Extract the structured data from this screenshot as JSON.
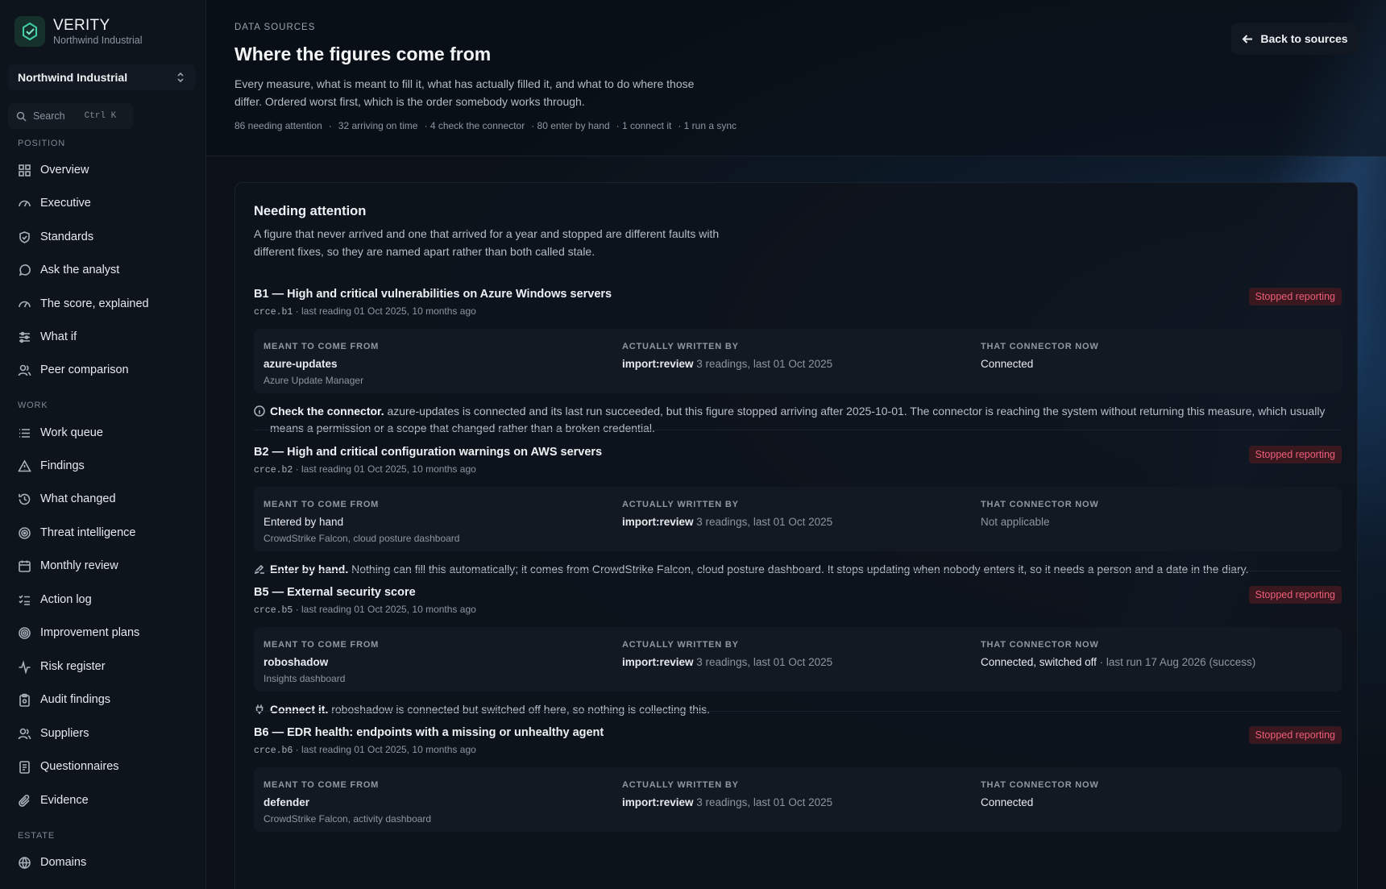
{
  "brand": {
    "name": "VERITY",
    "org": "Northwind Industrial"
  },
  "org_switcher": {
    "label": "Northwind Industrial"
  },
  "search": {
    "label": "Search",
    "shortcut": "Ctrl K"
  },
  "sidebar": {
    "sections": [
      {
        "label": "POSITION"
      },
      {
        "label": "WORK"
      },
      {
        "label": "ESTATE"
      }
    ],
    "items": [
      {
        "label": "Overview",
        "icon": "grid-icon"
      },
      {
        "label": "Executive",
        "icon": "gauge-icon"
      },
      {
        "label": "Standards",
        "icon": "shield-icon"
      },
      {
        "label": "Ask the analyst",
        "icon": "chat-icon"
      },
      {
        "label": "The score, explained",
        "icon": "gauge-icon"
      },
      {
        "label": "What if",
        "icon": "sliders-icon"
      },
      {
        "label": "Peer comparison",
        "icon": "users-icon"
      },
      {
        "label": "Work queue",
        "icon": "list-icon"
      },
      {
        "label": "Findings",
        "icon": "warning-icon"
      },
      {
        "label": "What changed",
        "icon": "history-icon"
      },
      {
        "label": "Threat intelligence",
        "icon": "radar-icon"
      },
      {
        "label": "Monthly review",
        "icon": "calendar-icon"
      },
      {
        "label": "Action log",
        "icon": "checklist-icon"
      },
      {
        "label": "Improvement plans",
        "icon": "target-icon"
      },
      {
        "label": "Risk register",
        "icon": "pulse-icon"
      },
      {
        "label": "Audit findings",
        "icon": "clipboard-icon"
      },
      {
        "label": "Suppliers",
        "icon": "users-icon"
      },
      {
        "label": "Questionnaires",
        "icon": "form-icon"
      },
      {
        "label": "Evidence",
        "icon": "paperclip-icon"
      },
      {
        "label": "Domains",
        "icon": "globe-icon"
      }
    ]
  },
  "header": {
    "eyebrow": "DATA SOURCES",
    "title": "Where the figures come from",
    "description": "Every measure, what is meant to fill it, what has actually filled it, and what to do where those differ. Ordered worst first, which is the order somebody works through.",
    "stats": [
      "86 needing attention",
      "·",
      "32 arriving on time",
      "· 4 check the connector",
      "· 80 enter by hand",
      "· 1 connect it",
      "· 1 run a sync"
    ],
    "back_label": "Back to sources"
  },
  "panel": {
    "title": "Needing attention",
    "description": "A figure that never arrived and one that arrived for a year and stopped are different faults with different fixes, so they are named apart rather than both called stale.",
    "col_labels": {
      "from": "MEANT TO COME FROM",
      "written": "ACTUALLY WRITTEN BY",
      "connector": "THAT CONNECTOR NOW"
    },
    "items": [
      {
        "title": "B1 — High and critical vulnerabilities on Azure Windows servers",
        "code": "crce.b1",
        "meta": " · last reading 01 Oct 2025, 10 months ago",
        "badge": "Stopped reporting",
        "from": "azure-updates",
        "from_sub": "Azure Update Manager",
        "written": "import:review",
        "written_meta": " 3 readings, last 01 Oct 2025",
        "connector": "Connected",
        "connector_meta": "",
        "note_title": "Check the connector.",
        "note_text": " azure-updates is connected and its last run succeeded, but this figure stopped arriving after 2025-10-01. The connector is reaching the system without returning this measure, which usually means a permission or a scope that changed rather than a broken credential."
      },
      {
        "title": "B2 — High and critical configuration warnings on AWS servers",
        "code": "crce.b2",
        "meta": " · last reading 01 Oct 2025, 10 months ago",
        "badge": "Stopped reporting",
        "from": "Entered by hand",
        "from_sub": "CrowdStrike Falcon, cloud posture dashboard",
        "written": "import:review",
        "written_meta": " 3 readings, last 01 Oct 2025",
        "connector": "Not applicable",
        "connector_meta": "",
        "note_title": "Enter by hand.",
        "note_text": " Nothing can fill this automatically; it comes from CrowdStrike Falcon, cloud posture dashboard. It stops updating when nobody enters it, so it needs a person and a date in the diary."
      },
      {
        "title": "B5 — External security score",
        "code": "crce.b5",
        "meta": " · last reading 01 Oct 2025, 10 months ago",
        "badge": "Stopped reporting",
        "from": "roboshadow",
        "from_sub": "Insights dashboard",
        "written": "import:review",
        "written_meta": " 3 readings, last 01 Oct 2025",
        "connector": "Connected, switched off",
        "connector_meta": " · last run 17 Aug 2026 (success)",
        "note_title": "Connect it.",
        "note_text": " roboshadow is connected but switched off here, so nothing is collecting this."
      },
      {
        "title": "B6 — EDR health: endpoints with a missing or unhealthy agent",
        "code": "crce.b6",
        "meta": " · last reading 01 Oct 2025, 10 months ago",
        "badge": "Stopped reporting",
        "from": "defender",
        "from_sub": "CrowdStrike Falcon, activity dashboard",
        "written": "import:review",
        "written_meta": " 3 readings, last 01 Oct 2025",
        "connector": "Connected",
        "connector_meta": "",
        "note_title": "",
        "note_text": ""
      }
    ]
  }
}
